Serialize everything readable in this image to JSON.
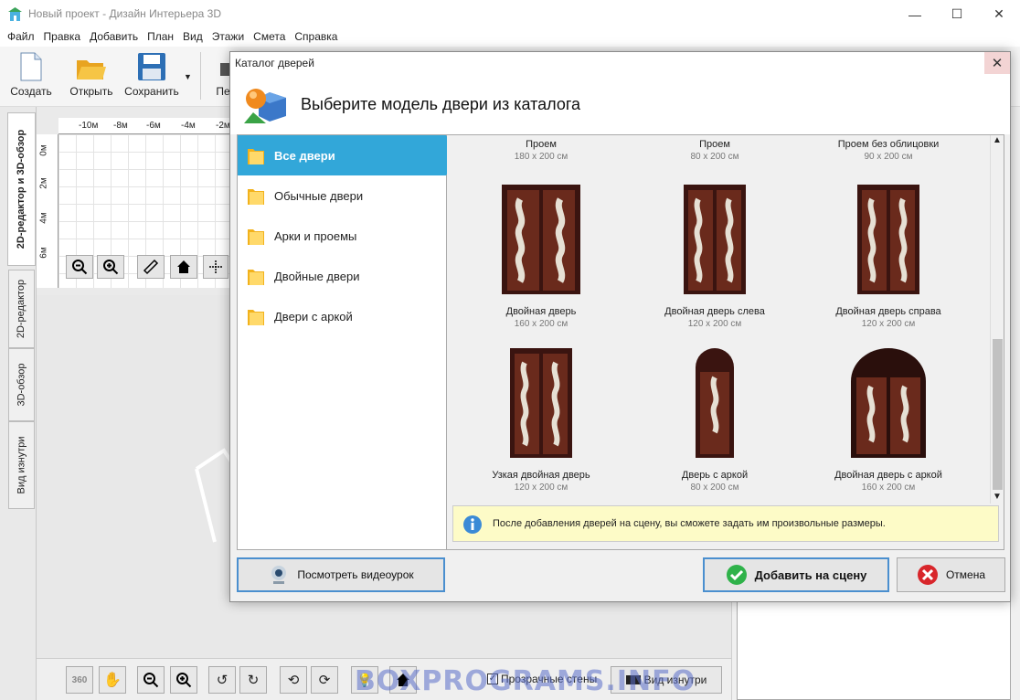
{
  "window": {
    "title": "Новый проект - Дизайн Интерьера 3D",
    "minimize": "—",
    "maximize": "☐",
    "close": "✕"
  },
  "menu": [
    "Файл",
    "Правка",
    "Добавить",
    "План",
    "Вид",
    "Этажи",
    "Смета",
    "Справка"
  ],
  "toolbar": {
    "create": "Создать",
    "open": "Открыть",
    "save": "Сохранить",
    "print_partial": "Печ"
  },
  "side_tabs": [
    "2D-редактор и 3D-обзор",
    "2D-редактор",
    "3D-обзор",
    "Вид изнутри"
  ],
  "ruler": {
    "top": [
      "-10м",
      "-8м",
      "-6м",
      "-4м",
      "-2м"
    ],
    "left": [
      "0м",
      "2м",
      "4м",
      "6м"
    ]
  },
  "bottom": {
    "transparent_walls": "Прозрачные стены",
    "inside_view": "Вид изнутри"
  },
  "dialog": {
    "title": "Каталог дверей",
    "close": "✕",
    "heading": "Выберите модель двери из каталога",
    "categories": [
      "Все двери",
      "Обычные двери",
      "Арки и проемы",
      "Двойные двери",
      "Двери с аркой"
    ],
    "top_row": [
      {
        "name": "Проем",
        "size": "180 x 200 см"
      },
      {
        "name": "Проем",
        "size": "80 x 200 см"
      },
      {
        "name": "Проем без облицовки",
        "size": "90 x 200 см"
      }
    ],
    "doors": [
      {
        "name": "Двойная дверь",
        "size": "160 x 200 см",
        "shape": "double"
      },
      {
        "name": "Двойная дверь слева",
        "size": "120 x 200 см",
        "shape": "double"
      },
      {
        "name": "Двойная дверь справа",
        "size": "120 x 200 см",
        "shape": "double"
      },
      {
        "name": "Узкая двойная дверь",
        "size": "120 x 200 см",
        "shape": "double"
      },
      {
        "name": "Дверь с аркой",
        "size": "80 x 200 см",
        "shape": "arch-single"
      },
      {
        "name": "Двойная дверь с аркой",
        "size": "160 x 200 см",
        "shape": "arch-double"
      }
    ],
    "info": "После добавления дверей на сцену, вы сможете задать им произвольные размеры.",
    "watch_video": "Посмотреть видеоурок",
    "add": "Добавить на сцену",
    "cancel": "Отмена"
  },
  "watermark": "BOXPROGRAMS.INFO",
  "colors": {
    "accent": "#32a7d9",
    "door_wood": "#5a1e16",
    "info_bg": "#fdfbc7",
    "ok_green": "#2fb24a",
    "cancel_red": "#d8262b"
  }
}
